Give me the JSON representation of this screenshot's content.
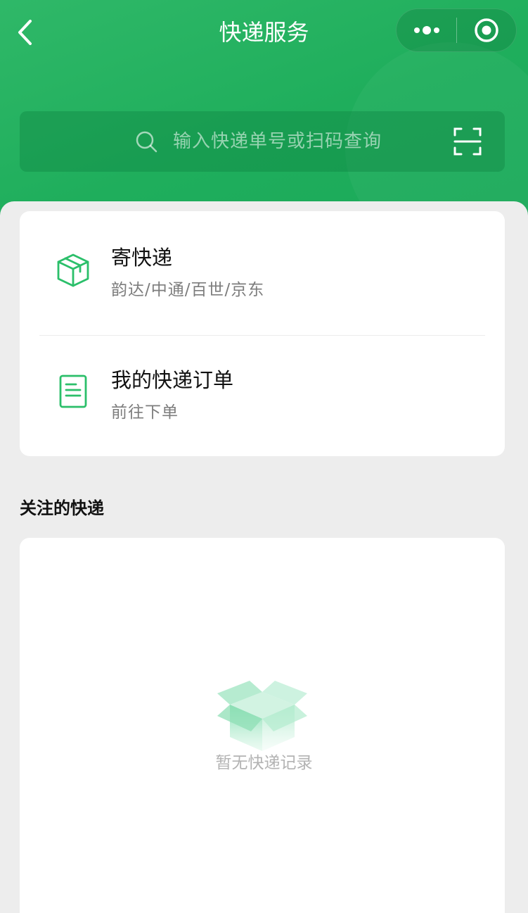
{
  "header": {
    "title": "快递服务",
    "back_icon": "chevron-left-icon",
    "more_icon": "more-dots-icon",
    "close_icon": "target-close-icon"
  },
  "search": {
    "placeholder": "输入快递单号或扫码查询",
    "search_icon": "search-icon",
    "scan_icon": "scan-icon"
  },
  "menu": {
    "items": [
      {
        "title": "寄快递",
        "subtitle": "韵达/中通/百世/京东",
        "icon": "package-icon"
      },
      {
        "title": "我的快递订单",
        "subtitle": "前往下单",
        "icon": "document-icon"
      }
    ]
  },
  "followed": {
    "section_title": "关注的快递",
    "empty_text": "暂无快递记录",
    "empty_icon": "empty-box-icon"
  },
  "colors": {
    "brand_green": "#1fae5c",
    "icon_green": "#2bbf6a",
    "page_bg": "#ededed"
  }
}
